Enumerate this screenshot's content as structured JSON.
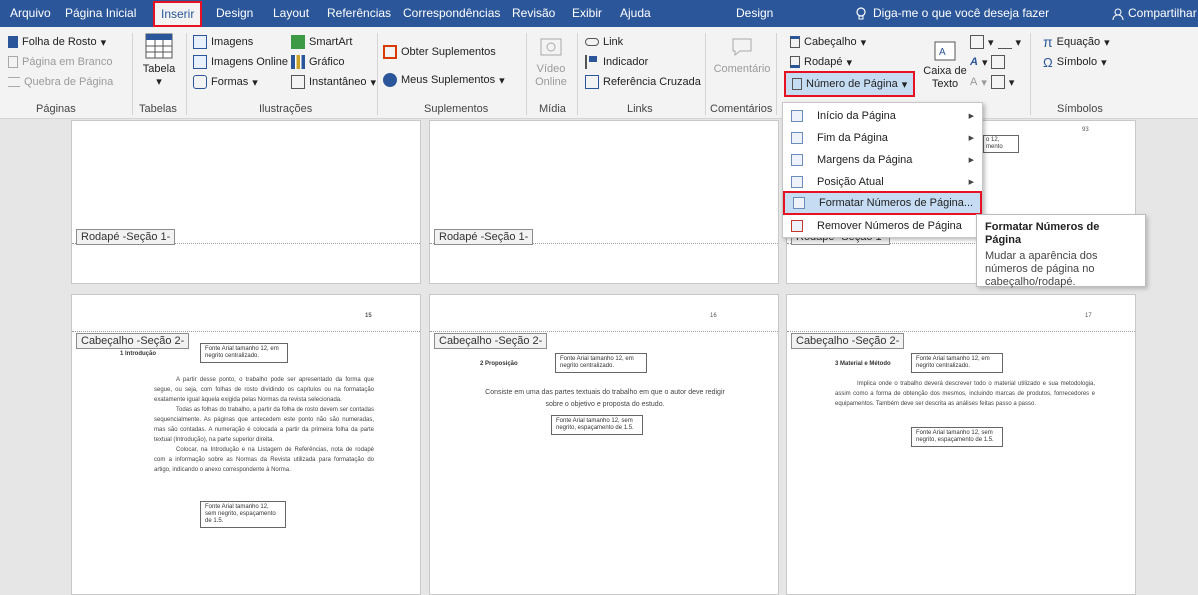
{
  "tabs": [
    "Arquivo",
    "Página Inicial",
    "Inserir",
    "Design",
    "Layout",
    "Referências",
    "Correspondências",
    "Revisão",
    "Exibir",
    "Ajuda",
    "Design"
  ],
  "tell_me": "Diga-me o que você deseja fazer",
  "share": "Compartilhar",
  "ribbon": {
    "paginas": {
      "cover": "Folha de Rosto",
      "blank": "Página em Branco",
      "break": "Quebra de Página",
      "group": "Páginas"
    },
    "tabelas": {
      "table": "Tabela",
      "group": "Tabelas"
    },
    "ilustracoes": {
      "images": "Imagens",
      "online_images": "Imagens Online",
      "shapes": "Formas",
      "smartart": "SmartArt",
      "chart": "Gráfico",
      "screenshot": "Instantâneo",
      "group": "Ilustrações"
    },
    "suplementos": {
      "get": "Obter Suplementos",
      "my": "Meus Suplementos",
      "group": "Suplementos"
    },
    "midia": {
      "video": "Vídeo Online",
      "group": "Mídia"
    },
    "links": {
      "link": "Link",
      "bookmark": "Indicador",
      "crossref": "Referência Cruzada",
      "group": "Links"
    },
    "comentarios": {
      "comment": "Comentário",
      "group": "Comentários"
    },
    "header_footer": {
      "header": "Cabeçalho",
      "footer": "Rodapé",
      "pagenum": "Número de Página"
    },
    "text": {
      "textbox": "Caixa de Texto"
    },
    "simbolos": {
      "equation": "Equação",
      "symbol": "Símbolo",
      "group": "Símbolos"
    }
  },
  "menu": {
    "items": [
      "Início da Página",
      "Fim da Página",
      "Margens da Página",
      "Posição Atual",
      "Formatar Números de Página...",
      "Remover Números de Página"
    ]
  },
  "tooltip": {
    "title": "Formatar Números de Página",
    "desc": "Mudar a aparência dos números de página no cabeçalho/rodapé."
  },
  "pages": {
    "footer_label": "Rodapé -Seção 1-",
    "header_label": "Cabeçalho -Seção 2-",
    "p1": {
      "num": "15",
      "heading": "1 Introdução",
      "note1": "Fonte Arial tamanho 12, em negrito centralizado.",
      "para1": "A partir desse ponto, o trabalho pode ser apresentado da forma que segue, ou seja, com folhas de rosto dividindo os capítulos ou na formatação exatamente igual àquela exigida pelas Normas da revista selecionada.",
      "para2": "Todas as folhas do trabalho, a partir da folha de rosto devem ser contadas sequencialmente. As páginas que antecedem este ponto não são numeradas, mas são contadas. A numeração é colocada a partir da primeira folha da parte textual (Introdução), na parte superior direita.",
      "para3": "Colocar, na Introdução e na Listagem de Referências, nota de rodapé com a informação sobre as Normas da Revista utilizada para formatação do artigo, indicando o anexo correspondente à Norma.",
      "note2": "Fonte Arial tamanho 12, sem negrito, espaçamento de 1.5."
    },
    "p2": {
      "num": "16",
      "heading": "2 Proposição",
      "note1": "Fonte Arial tamanho 12, em negrito centralizado.",
      "para1": "Consiste em uma das partes textuais do trabalho em que o autor deve redigir sobre o objetivo e proposta do estudo.",
      "note2": "Fonte Arial tamanho 12, sem negrito, espaçamento de 1.5."
    },
    "p3": {
      "num": "17",
      "heading": "3 Material e Método",
      "note1": "Fonte Arial tamanho 12, em negrito centralizado.",
      "para1": "Implica onde o trabalho deverá descrever todo o material utilizado e sua metodologia, assim como a forma de obtenção dos mesmos, incluindo marcas de produtos, fornecedores e equipamentos. Também deve ser descrita as análises feitas passo a passo.",
      "note2": "Fonte Arial tamanho 12, sem negrito, espaçamento de 1.5.",
      "peek1": "o 12,",
      "peek2": "mento",
      "peek3": "93"
    }
  }
}
